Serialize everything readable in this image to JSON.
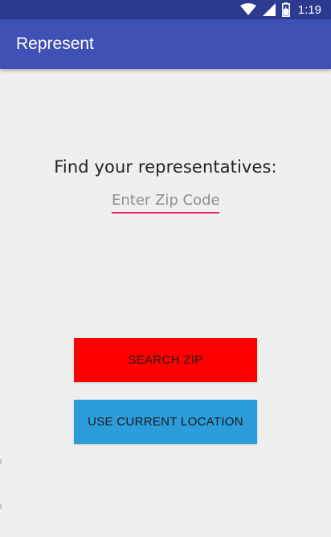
{
  "status_bar": {
    "time": "1:19",
    "color": "#2c3a8f",
    "icons": [
      "wifi-icon",
      "signal-icon",
      "battery-icon"
    ]
  },
  "app_bar": {
    "title": "Represent",
    "color": "#3f51b5"
  },
  "main": {
    "prompt": "Find your representatives:",
    "zip_input": {
      "value": "",
      "placeholder": "Enter Zip Code",
      "underline_color": "#e91e63"
    },
    "search_button": {
      "label": "SEARCH ZIP",
      "color": "#ff0000"
    },
    "location_button": {
      "label": "USE CURRENT LOCATION",
      "color": "#2d9cdb"
    }
  }
}
